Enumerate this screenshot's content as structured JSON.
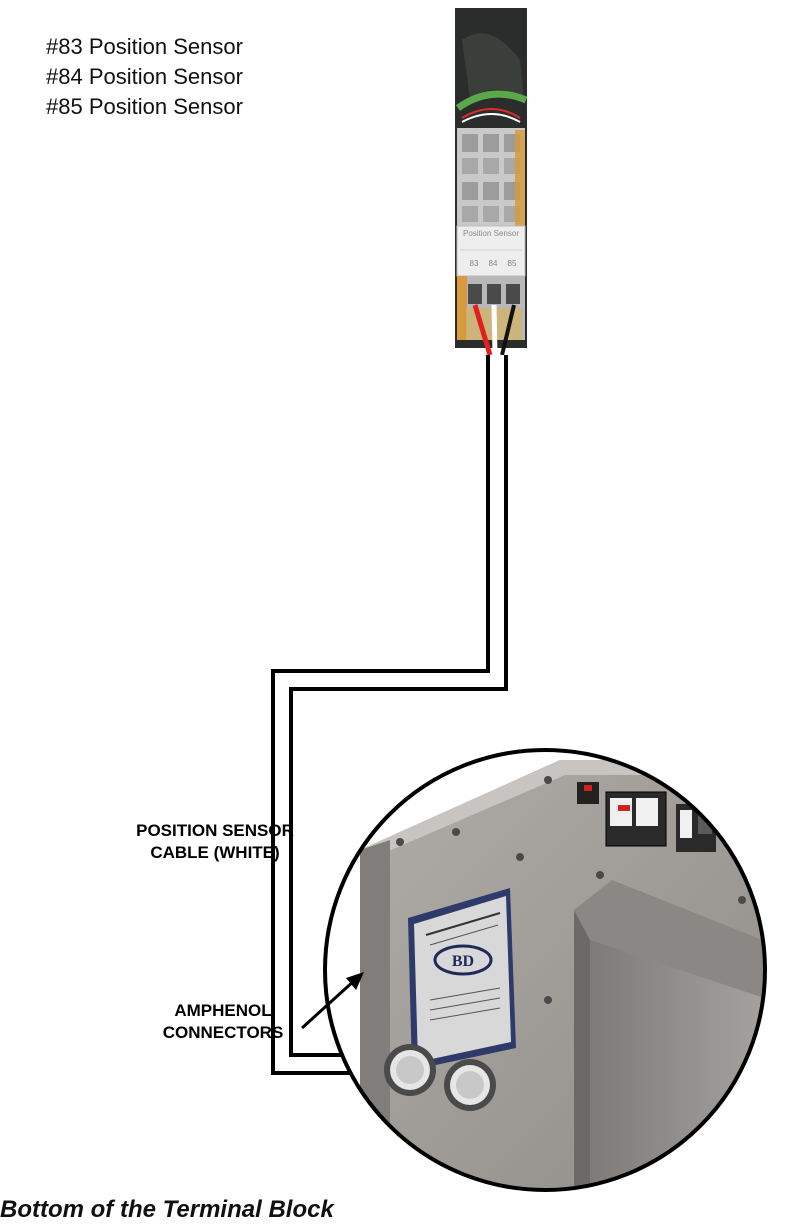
{
  "sensor_labels": [
    "#83 Position Sensor",
    "#84 Position Sensor",
    "#85 Position Sensor"
  ],
  "terminal_block": {
    "header": "Position Sensor",
    "terminals": [
      "83",
      "84",
      "85"
    ]
  },
  "cable_label": {
    "line1": "POSITION SENSOR",
    "line2": "CABLE (WHITE)"
  },
  "connector_label": {
    "line1": "AMPHENOL",
    "line2": "CONNECTORS"
  },
  "caption": "Bottom of the Terminal Block",
  "colors": {
    "wire_red": "#e0201c",
    "wire_black": "#111111",
    "enclosure_panel": "#9a9693",
    "terminal_gray": "#b8b8b8",
    "terminal_orange": "#d89a3a",
    "green_wire": "#5aa84a"
  }
}
